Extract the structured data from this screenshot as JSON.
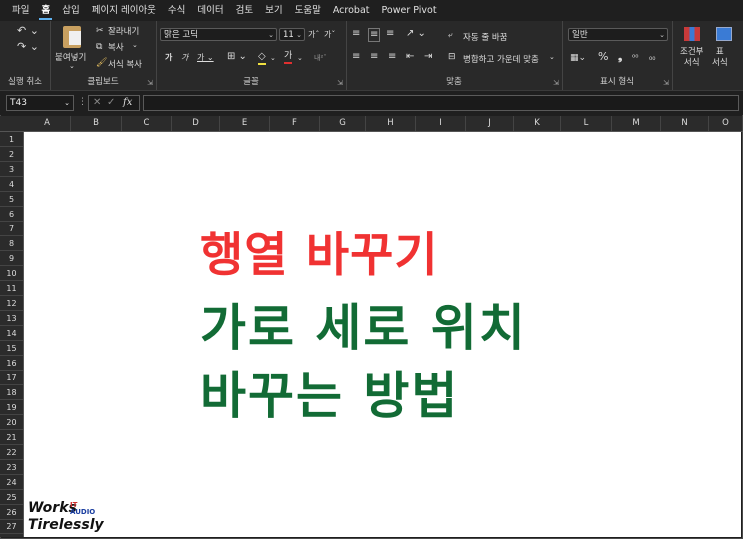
{
  "menu": [
    "파일",
    "홈",
    "삽입",
    "페이지 레이아웃",
    "수식",
    "데이터",
    "검토",
    "보기",
    "도움말",
    "Acrobat",
    "Power Pivot"
  ],
  "ribbon": {
    "undo_group": "실행 취소",
    "clipboard": {
      "label": "클립보드",
      "paste": "붙여넣기",
      "cut": "잘라내기",
      "copy": "복사",
      "format_painter": "서식 복사"
    },
    "font": {
      "label": "글꼴",
      "name": "맑은 고딕",
      "size": "11"
    },
    "alignment": {
      "label": "맞춤",
      "wrap": "자동 줄 바꿈",
      "merge": "병합하고 가운데 맞춤"
    },
    "number": {
      "label": "표시 형식",
      "format": "일반"
    },
    "styles": {
      "conditional": "조건부\n서식",
      "table": "표\n서식"
    }
  },
  "formula_bar": {
    "name_box": "T43",
    "fx": "fx",
    "formula": ""
  },
  "columns": [
    "A",
    "B",
    "C",
    "D",
    "E",
    "F",
    "G",
    "H",
    "I",
    "J",
    "K",
    "L",
    "M",
    "N",
    "O"
  ],
  "rows": [
    "1",
    "2",
    "3",
    "4",
    "5",
    "6",
    "7",
    "8",
    "9",
    "10",
    "11",
    "12",
    "13",
    "14",
    "15",
    "16",
    "17",
    "18",
    "19",
    "20",
    "21",
    "22",
    "23",
    "24",
    "25",
    "26",
    "27"
  ],
  "content": {
    "title_red": "행열 바꾸기",
    "line_green_1": "가로 세로 위치",
    "line_green_2": "바꾸는 방법"
  },
  "colors": {
    "red_text": "#f03232",
    "green_text": "#126b35",
    "accent": "#5fb2f0"
  },
  "logo": {
    "line1": "Works",
    "it": "IT",
    "audio": "AUDIO",
    "line2": "Tirelessly"
  }
}
